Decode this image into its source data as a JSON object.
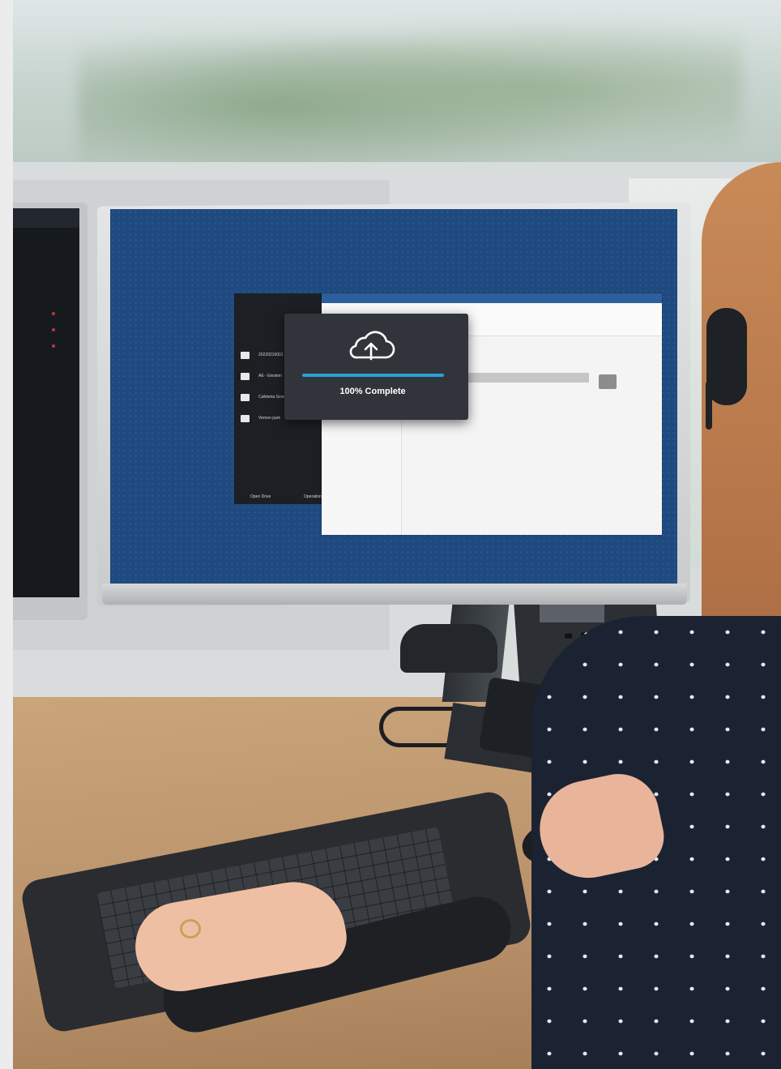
{
  "upload_dialog": {
    "icon": "cloud-upload-icon",
    "progress_label": "100% Complete",
    "progress_fraction": 1.0,
    "accent_color": "#29a3d8",
    "background_color": "#31343a"
  },
  "drive_panel": {
    "items": [
      {
        "icon": "folder-icon",
        "label": "20220216001"
      },
      {
        "icon": "folder-icon",
        "label": "AE - Einstein"
      },
      {
        "icon": "folder-icon",
        "label": "Cafeteria Scre"
      },
      {
        "icon": "folder-icon",
        "label": "Vernon park"
      }
    ],
    "footer": {
      "open_drive": "Open Drive",
      "operations": "Operations"
    }
  },
  "screen_color": "#1f4a80"
}
